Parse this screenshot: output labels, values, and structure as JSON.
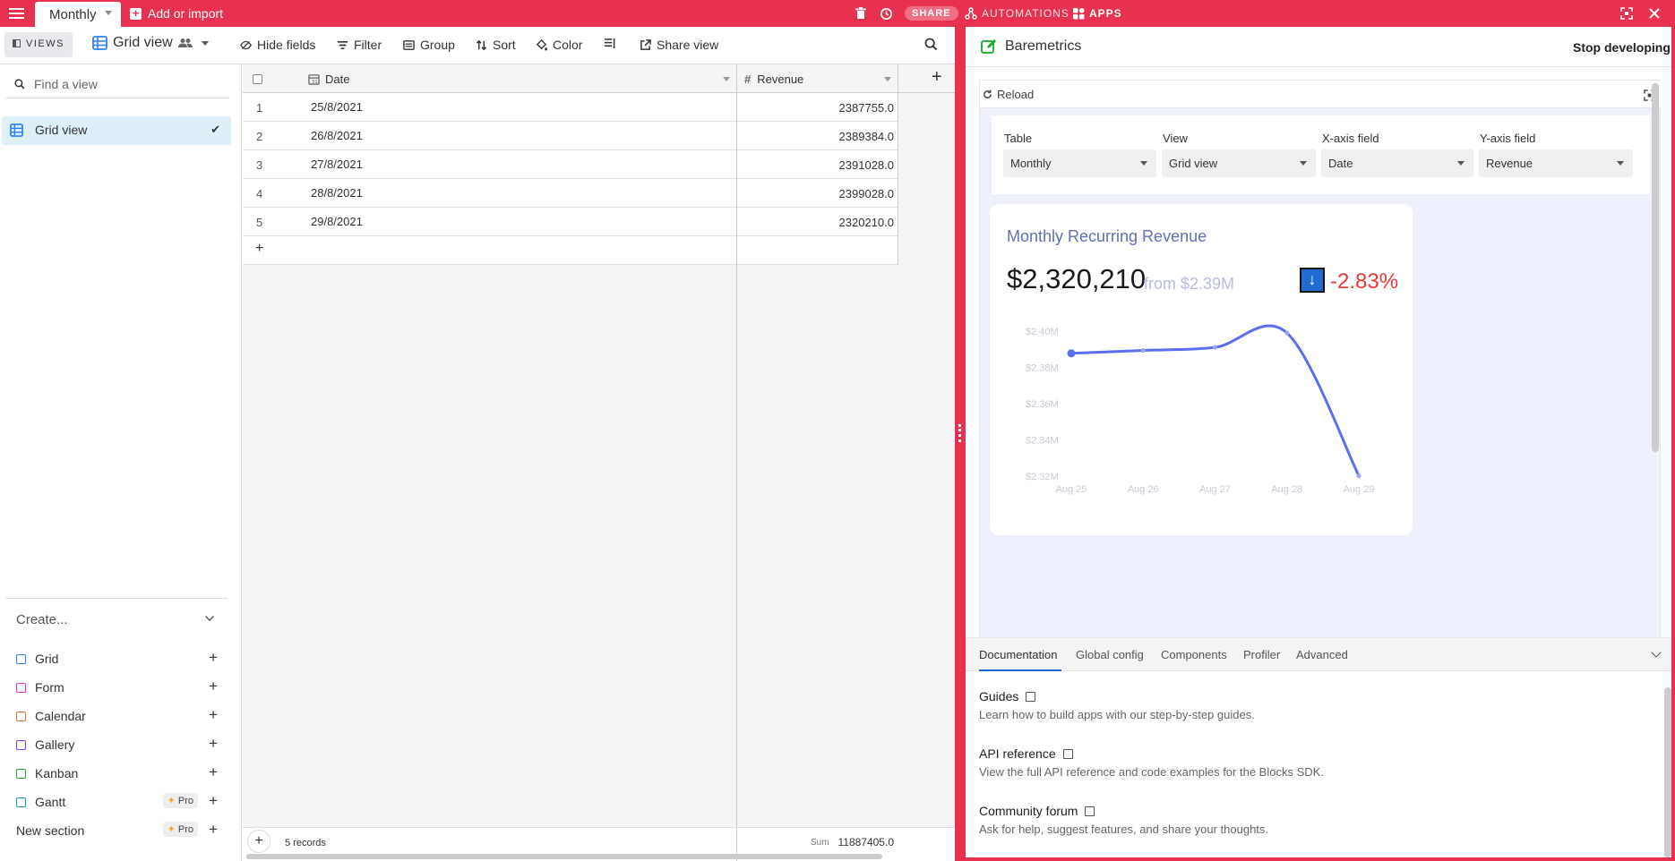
{
  "topbar": {
    "table_tab": "Monthly",
    "add_import": "Add or import",
    "share": "SHARE",
    "automations": "AUTOMATIONS",
    "apps": "APPS"
  },
  "toolbar": {
    "views": "VIEWS",
    "view_name": "Grid view",
    "hide_fields": "Hide fields",
    "filter": "Filter",
    "group": "Group",
    "sort": "Sort",
    "color": "Color",
    "share_view": "Share view"
  },
  "sidebar": {
    "find_placeholder": "Find a view",
    "selected_view": "Grid view",
    "create_heading": "Create...",
    "create_items": [
      {
        "label": "Grid",
        "color": "#2d7ff9"
      },
      {
        "label": "Form",
        "color": "#e929ba"
      },
      {
        "label": "Calendar",
        "color": "#f06a2b"
      },
      {
        "label": "Gallery",
        "color": "#7c39ed"
      },
      {
        "label": "Kanban",
        "color": "#11af22"
      },
      {
        "label": "Gantt",
        "color": "#0fa0a0",
        "badge": "Pro"
      },
      {
        "label": "New section",
        "badge": "Pro"
      }
    ]
  },
  "grid": {
    "columns": [
      "Date",
      "Revenue"
    ],
    "rows": [
      {
        "num": "1",
        "date": "25/8/2021",
        "revenue": "2387755.0"
      },
      {
        "num": "2",
        "date": "26/8/2021",
        "revenue": "2389384.0"
      },
      {
        "num": "3",
        "date": "27/8/2021",
        "revenue": "2391028.0"
      },
      {
        "num": "4",
        "date": "28/8/2021",
        "revenue": "2399028.0"
      },
      {
        "num": "5",
        "date": "29/8/2021",
        "revenue": "2320210.0"
      }
    ],
    "record_count": "5 records",
    "sum_label": "Sum",
    "sum_value": "11887405.0"
  },
  "app": {
    "name": "Baremetrics",
    "stop": "Stop developing",
    "reload": "Reload",
    "config": {
      "table_label": "Table",
      "table_value": "Monthly",
      "view_label": "View",
      "view_value": "Grid view",
      "x_label": "X-axis field",
      "x_value": "Date",
      "y_label": "Y-axis field",
      "y_value": "Revenue"
    },
    "card": {
      "title": "Monthly Recurring Revenue",
      "value": "$2,320,210",
      "from": "from $2.39M",
      "change": "-2.83%",
      "arrow": "↓"
    }
  },
  "chart_data": {
    "type": "line",
    "title": "Monthly Recurring Revenue",
    "categories": [
      "Aug 25",
      "Aug 26",
      "Aug 27",
      "Aug 28",
      "Aug 29"
    ],
    "values": [
      2387755,
      2389384,
      2391028,
      2399028,
      2320210
    ],
    "y_ticks": [
      "$2.40M",
      "$2.38M",
      "$2.36M",
      "$2.34M",
      "$2.32M"
    ],
    "ylim": [
      2320000,
      2400000
    ],
    "line_color": "#5b6ef0",
    "grid": false
  },
  "devtools": {
    "tabs": [
      "Documentation",
      "Global config",
      "Components",
      "Profiler",
      "Advanced"
    ],
    "docs": [
      {
        "title": "Guides",
        "desc": "Learn how to build apps with our step-by-step guides."
      },
      {
        "title": "API reference",
        "desc": "View the full API reference and code examples for the Blocks SDK."
      },
      {
        "title": "Community forum",
        "desc": "Ask for help, suggest features, and share your thoughts."
      }
    ]
  },
  "colors": {
    "brand": "#e8304f",
    "accent": "#1f6bd1",
    "negative": "#e53935"
  }
}
